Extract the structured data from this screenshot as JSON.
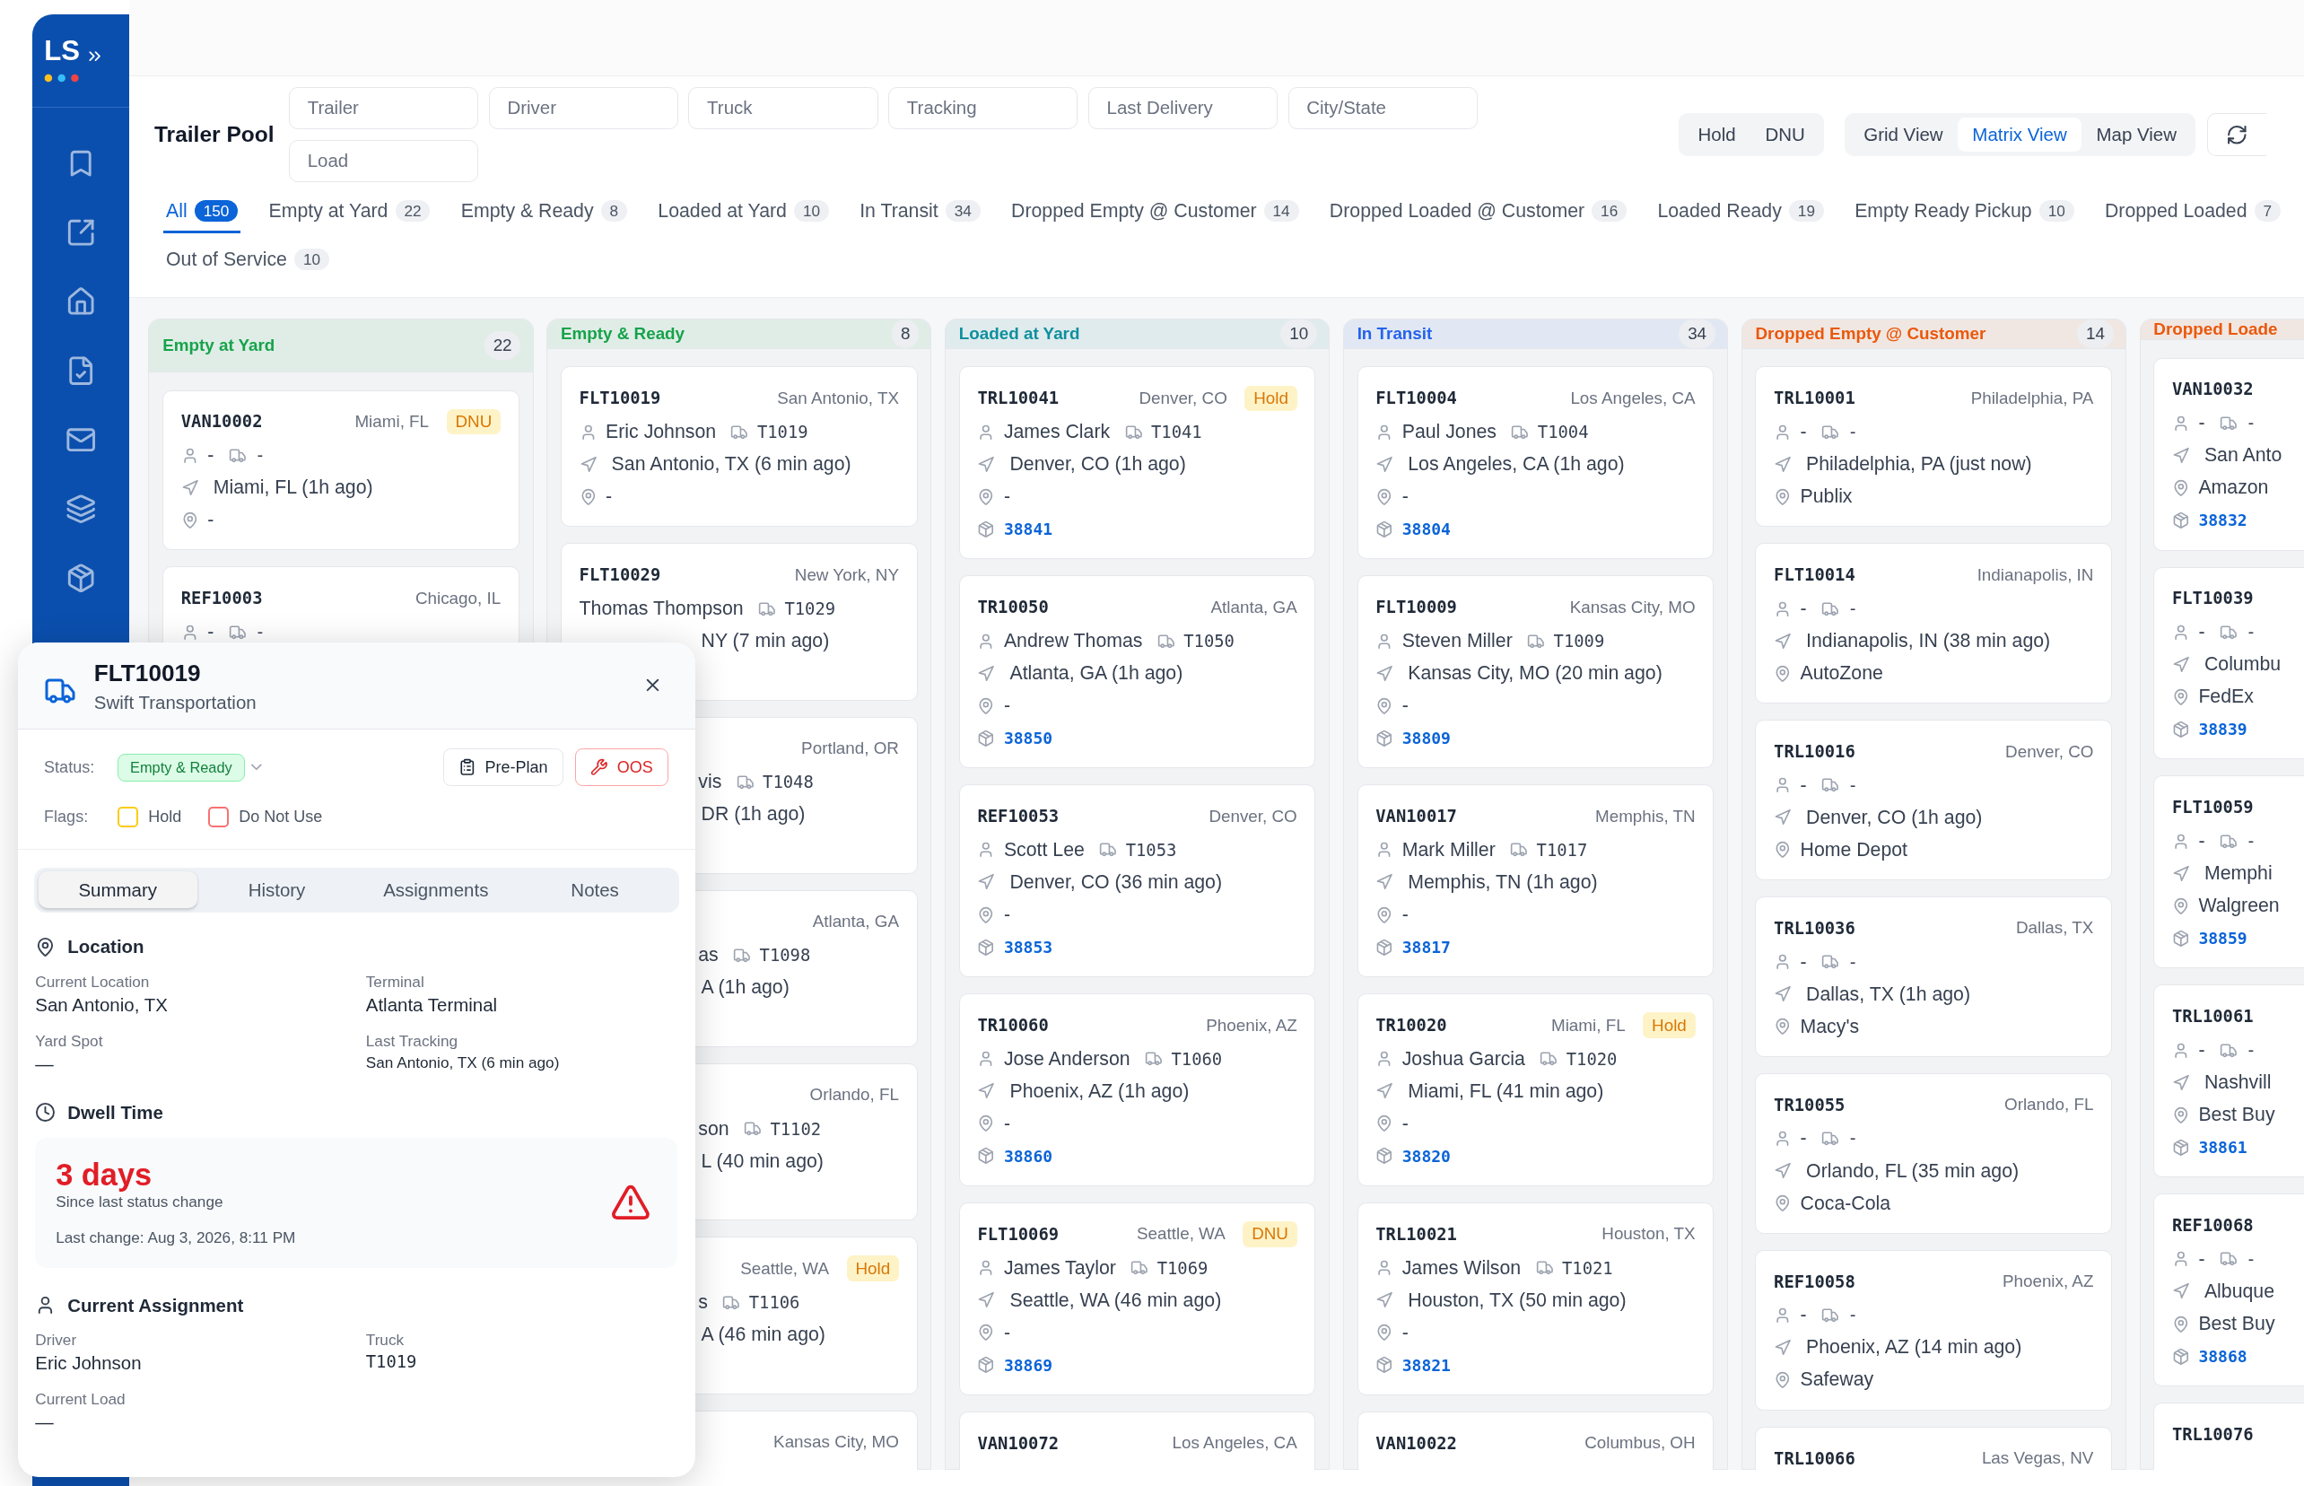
{
  "sidebar": {
    "logo": "LS"
  },
  "toolbar": {
    "title": "Trailer Pool",
    "filters": [
      {
        "placeholder": "Trailer"
      },
      {
        "placeholder": "Driver"
      },
      {
        "placeholder": "Truck"
      },
      {
        "placeholder": "Tracking"
      },
      {
        "placeholder": "Last Delivery"
      },
      {
        "placeholder": "City/State"
      },
      {
        "placeholder": "Load"
      }
    ],
    "flag_toggles": [
      {
        "label": "Hold",
        "selected": false
      },
      {
        "label": "DNU",
        "selected": false
      }
    ],
    "views": [
      {
        "label": "Grid View",
        "selected": false
      },
      {
        "label": "Matrix View",
        "selected": true
      },
      {
        "label": "Map View",
        "selected": false
      }
    ]
  },
  "tab_rows": [
    [
      {
        "label": "All",
        "count": "150",
        "selected": true
      },
      {
        "label": "Empty at Yard",
        "count": "22",
        "selected": false
      },
      {
        "label": "Empty & Ready",
        "count": "8",
        "selected": false
      },
      {
        "label": "Loaded at Yard",
        "count": "10",
        "selected": false
      },
      {
        "label": "In Transit",
        "count": "34",
        "selected": false
      },
      {
        "label": "Dropped Empty @ Customer",
        "count": "14",
        "selected": false
      },
      {
        "label": "Dropped Loaded @ Customer",
        "count": "16",
        "selected": false
      },
      {
        "label": "Loaded Ready",
        "count": "19",
        "selected": false
      },
      {
        "label": "Empty Ready Pickup",
        "count": "10",
        "selected": false
      },
      {
        "label": "Dropped Loaded",
        "count": "7",
        "selected": false
      }
    ],
    [
      {
        "label": "Out of Service",
        "count": "10",
        "selected": false
      }
    ]
  ],
  "columns": [
    {
      "title": "Empty at Yard",
      "count": "22",
      "color": "#16a34a",
      "cards": [
        {
          "id": "VAN10002",
          "city": "Miami, FL",
          "badge": "DNU",
          "driver": "-",
          "truck": "-",
          "location": "Miami, FL (1h ago)",
          "site": "-"
        },
        {
          "id": "REF10003",
          "city": "Chicago, IL",
          "driver": "-",
          "truck": "-"
        }
      ]
    },
    {
      "title": "Empty & Ready",
      "count": "8",
      "color": "#16a34a",
      "cards": [
        {
          "id": "FLT10019",
          "city": "San Antonio, TX",
          "driver": "Eric Johnson",
          "truck": "T1019",
          "location": "San Antonio, TX (6 min ago)",
          "site": "-"
        },
        {
          "id": "FLT10029",
          "city": "New York, NY",
          "driver": "Thomas Thompson",
          "truck": "T1029",
          "location": "NY (7 min ago)"
        },
        {
          "city": "Portland, OR",
          "driver": "vis",
          "truck": "T1048",
          "location": "DR (1h ago)"
        },
        {
          "city": "Atlanta, GA",
          "driver": "as",
          "truck": "T1098",
          "location": "A (1h ago)"
        },
        {
          "city": "Orlando, FL",
          "driver": "son",
          "truck": "T1102",
          "location": "L (40 min ago)"
        },
        {
          "city": "Seattle, WA",
          "badge": "Hold",
          "driver": "s",
          "truck": "T1106",
          "location": "A (46 min ago)"
        },
        {
          "city": "Kansas City, MO"
        }
      ]
    },
    {
      "title": "Loaded at Yard",
      "count": "10",
      "color": "#0e8f9e",
      "cards": [
        {
          "id": "TRL10041",
          "city": "Denver, CO",
          "badge": "Hold",
          "driver": "James Clark",
          "truck": "T1041",
          "location": "Denver, CO (1h ago)",
          "site": "-",
          "load": "38841"
        },
        {
          "id": "TR10050",
          "city": "Atlanta, GA",
          "driver": "Andrew Thomas",
          "truck": "T1050",
          "location": "Atlanta, GA (1h ago)",
          "site": "-",
          "load": "38850"
        },
        {
          "id": "REF10053",
          "city": "Denver, CO",
          "driver": "Scott Lee",
          "truck": "T1053",
          "location": "Denver, CO (36 min ago)",
          "site": "-",
          "load": "38853"
        },
        {
          "id": "TR10060",
          "city": "Phoenix, AZ",
          "driver": "Jose Anderson",
          "truck": "T1060",
          "location": "Phoenix, AZ (1h ago)",
          "site": "-",
          "load": "38860"
        },
        {
          "id": "FLT10069",
          "city": "Seattle, WA",
          "badge": "DNU",
          "driver": "James Taylor",
          "truck": "T1069",
          "location": "Seattle, WA (46 min ago)",
          "site": "-",
          "load": "38869"
        },
        {
          "id": "VAN10072",
          "city": "Los Angeles, CA"
        }
      ]
    },
    {
      "title": "In Transit",
      "count": "34",
      "color": "#2563eb",
      "cards": [
        {
          "id": "FLT10004",
          "city": "Los Angeles, CA",
          "driver": "Paul Jones",
          "truck": "T1004",
          "location": "Los Angeles, CA (1h ago)",
          "site": "-",
          "load": "38804"
        },
        {
          "id": "FLT10009",
          "city": "Kansas City, MO",
          "driver": "Steven Miller",
          "truck": "T1009",
          "location": "Kansas City, MO (20 min ago)",
          "site": "-",
          "load": "38809"
        },
        {
          "id": "VAN10017",
          "city": "Memphis, TN",
          "driver": "Mark Miller",
          "truck": "T1017",
          "location": "Memphis, TN (1h ago)",
          "site": "-",
          "load": "38817"
        },
        {
          "id": "TR10020",
          "city": "Miami, FL",
          "badge": "Hold",
          "driver": "Joshua Garcia",
          "truck": "T1020",
          "location": "Miami, FL (41 min ago)",
          "site": "-",
          "load": "38820"
        },
        {
          "id": "TRL10021",
          "city": "Houston, TX",
          "driver": "James Wilson",
          "truck": "T1021",
          "location": "Houston, TX (50 min ago)",
          "site": "-",
          "load": "38821"
        },
        {
          "id": "VAN10022",
          "city": "Columbus, OH"
        }
      ]
    },
    {
      "title": "Dropped Empty @ Customer",
      "count": "14",
      "color": "#ea580c",
      "cards": [
        {
          "id": "TRL10001",
          "city": "Philadelphia, PA",
          "driver": "-",
          "truck": "-",
          "location": "Philadelphia, PA (just now)",
          "site": "Publix"
        },
        {
          "id": "FLT10014",
          "city": "Indianapolis, IN",
          "driver": "-",
          "truck": "-",
          "location": "Indianapolis, IN (38 min ago)",
          "site": "AutoZone"
        },
        {
          "id": "TRL10016",
          "city": "Denver, CO",
          "driver": "-",
          "truck": "-",
          "location": "Denver, CO (1h ago)",
          "site": "Home Depot"
        },
        {
          "id": "TRL10036",
          "city": "Dallas, TX",
          "driver": "-",
          "truck": "-",
          "location": "Dallas, TX (1h ago)",
          "site": "Macy's"
        },
        {
          "id": "TR10055",
          "city": "Orlando, FL",
          "driver": "-",
          "truck": "-",
          "location": "Orlando, FL (35 min ago)",
          "site": "Coca-Cola"
        },
        {
          "id": "REF10058",
          "city": "Phoenix, AZ",
          "driver": "-",
          "truck": "-",
          "location": "Phoenix, AZ (14 min ago)",
          "site": "Safeway"
        },
        {
          "id": "TRL10066",
          "city": "Las Vegas, NV"
        }
      ]
    },
    {
      "title": "Dropped Loade",
      "color": "#ea580c",
      "cards": [
        {
          "id": "VAN10032",
          "driver": "-",
          "truck": "-",
          "location": "San Anto",
          "site": "Amazon",
          "load": "38832"
        },
        {
          "id": "FLT10039",
          "driver": "-",
          "truck": "-",
          "location": "Columbu",
          "site": "FedEx",
          "load": "38839"
        },
        {
          "id": "FLT10059",
          "driver": "-",
          "truck": "-",
          "location": "Memphi",
          "site": "Walgreen",
          "load": "38859"
        },
        {
          "id": "TRL10061",
          "driver": "-",
          "truck": "-",
          "location": "Nashvill",
          "site": "Best Buy",
          "load": "38861"
        },
        {
          "id": "REF10068",
          "driver": "-",
          "truck": "-",
          "location": "Albuque",
          "site": "Best Buy",
          "load": "38868"
        },
        {
          "id": "TRL10076"
        }
      ]
    }
  ],
  "detail": {
    "title": "FLT10019",
    "subtitle": "Swift Transportation",
    "status_label": "Status:",
    "status": "Empty & Ready",
    "actions": [
      {
        "label": "Pre-Plan",
        "kind": "plan"
      },
      {
        "label": "OOS",
        "kind": "oos"
      }
    ],
    "flags_label": "Flags:",
    "flags": [
      {
        "label": "Hold",
        "checked": false,
        "color": "#facc15"
      },
      {
        "label": "Do Not Use",
        "checked": false,
        "color": "#f87171"
      }
    ],
    "tabs": [
      {
        "label": "Summary",
        "selected": true
      },
      {
        "label": "History",
        "selected": false
      },
      {
        "label": "Assignments",
        "selected": false
      },
      {
        "label": "Notes",
        "selected": false
      }
    ],
    "sections": [
      {
        "kind": "location",
        "title": "Location",
        "fields": [
          {
            "label": "Current Location",
            "value": "San Antonio, TX",
            "kind": "text"
          },
          {
            "label": "Terminal",
            "value": "Atlanta Terminal",
            "kind": "text"
          },
          {
            "label": "Yard Spot",
            "value": "—",
            "kind": "text"
          },
          {
            "label": "Last Tracking",
            "value": "San Antonio, TX (6 min ago)",
            "kind": "small"
          }
        ]
      },
      {
        "kind": "dwell",
        "title": "Dwell Time",
        "value": "3 days",
        "caption": "Since last status change",
        "note": "Last change: Aug 3, 2026, 8:11 PM"
      },
      {
        "kind": "assignment",
        "title": "Current Assignment",
        "fields": [
          {
            "label": "Driver",
            "value": "Eric Johnson",
            "kind": "text"
          },
          {
            "label": "Truck",
            "value": "T1019",
            "kind": "mono"
          },
          {
            "label": "Current Load",
            "value": "—",
            "kind": "text"
          }
        ]
      }
    ]
  }
}
